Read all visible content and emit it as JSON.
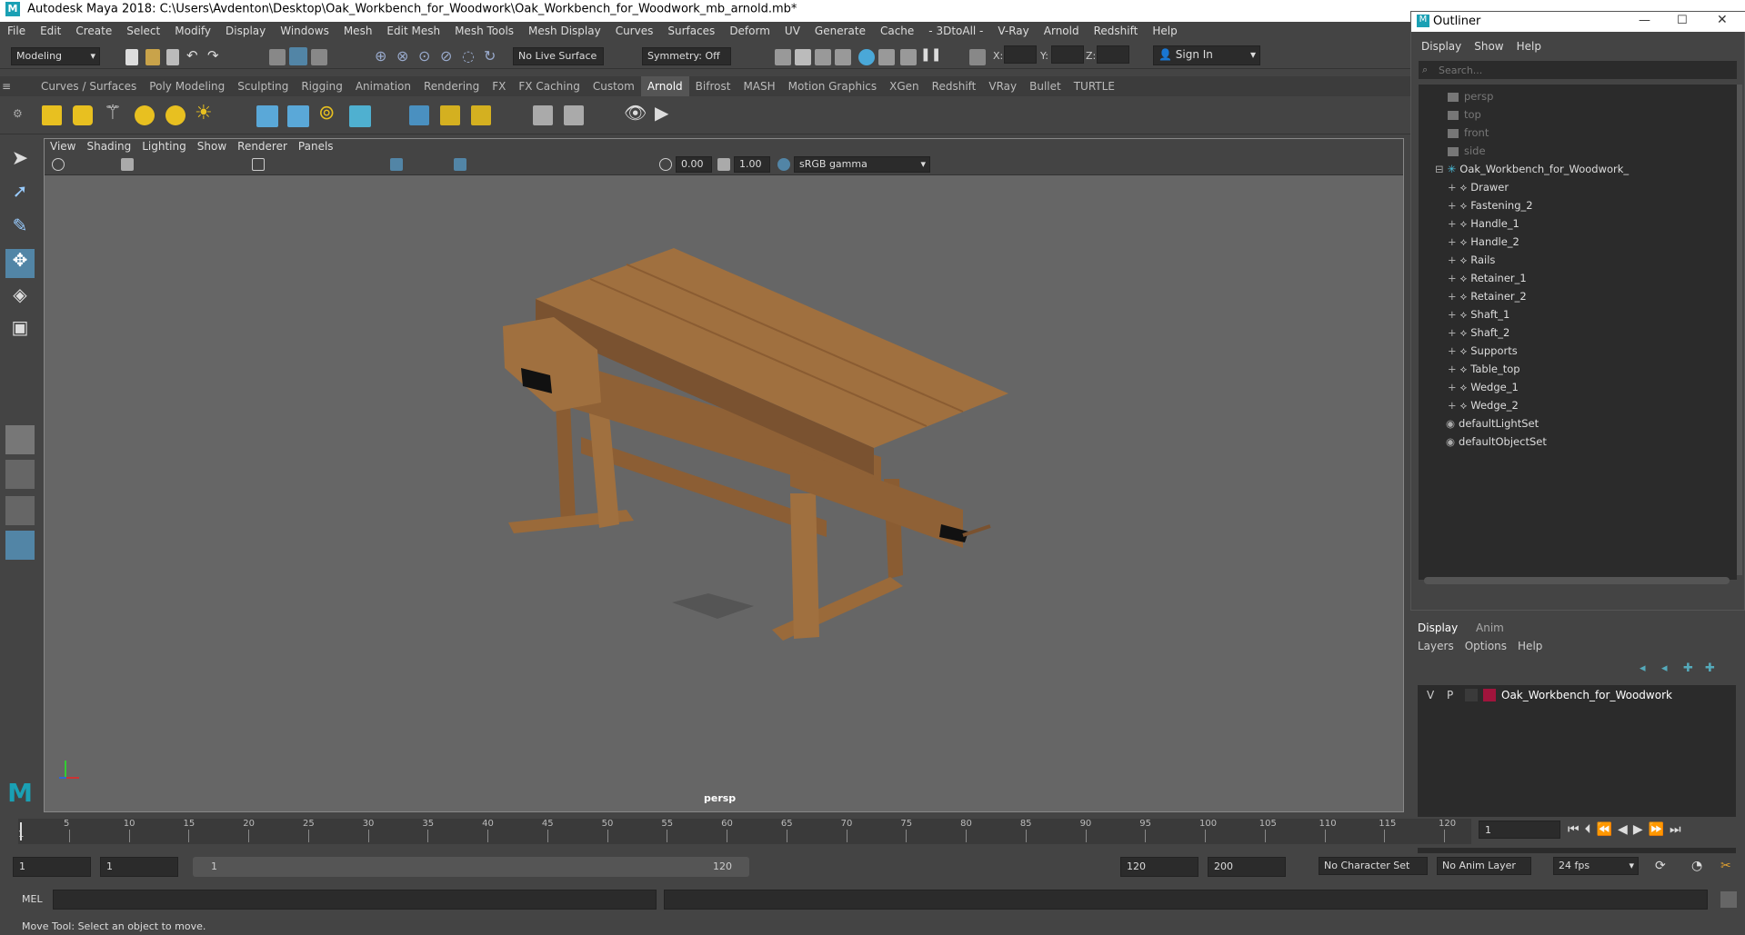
{
  "window": {
    "title": "Autodesk Maya 2018: C:\\Users\\Avdenton\\Desktop\\Oak_Workbench_for_Woodwork\\Oak_Workbench_for_Woodwork_mb_arnold.mb*"
  },
  "menubar": [
    "File",
    "Edit",
    "Create",
    "Select",
    "Modify",
    "Display",
    "Windows",
    "Mesh",
    "Edit Mesh",
    "Mesh Tools",
    "Mesh Display",
    "Curves",
    "Surfaces",
    "Deform",
    "UV",
    "Generate",
    "Cache",
    "- 3DtoAll -",
    "V-Ray",
    "Arnold",
    "Redshift",
    "Help"
  ],
  "statusline": {
    "mode": "Modeling",
    "live_surface": "No Live Surface",
    "symmetry": "Symmetry: Off",
    "x_label": "X:",
    "y_label": "Y:",
    "z_label": "Z:",
    "sign_in": "Sign In"
  },
  "shelf_tabs": [
    "Curves / Surfaces",
    "Poly Modeling",
    "Sculpting",
    "Rigging",
    "Animation",
    "Rendering",
    "FX",
    "FX Caching",
    "Custom",
    "Arnold",
    "Bifrost",
    "MASH",
    "Motion Graphics",
    "XGen",
    "Redshift",
    "VRay",
    "Bullet",
    "TURTLE"
  ],
  "shelf_active": "Arnold",
  "viewport": {
    "menu": [
      "View",
      "Shading",
      "Lighting",
      "Show",
      "Renderer",
      "Panels"
    ],
    "exposure": "0.00",
    "gamma": "1.00",
    "colorspace": "sRGB gamma",
    "camera_label": "persp"
  },
  "outliner": {
    "title": "Outliner",
    "menu": [
      "Display",
      "Show",
      "Help"
    ],
    "search_placeholder": "Search...",
    "cameras": [
      "persp",
      "top",
      "front",
      "side"
    ],
    "root": "Oak_Workbench_for_Woodwork_",
    "children": [
      "Drawer",
      "Fastening_2",
      "Handle_1",
      "Handle_2",
      "Rails",
      "Retainer_1",
      "Retainer_2",
      "Shaft_1",
      "Shaft_2",
      "Supports",
      "Table_top",
      "Wedge_1",
      "Wedge_2"
    ],
    "sets": [
      "defaultLightSet",
      "defaultObjectSet"
    ]
  },
  "layers": {
    "tabs": [
      "Display",
      "Anim"
    ],
    "menu": [
      "Layers",
      "Options",
      "Help"
    ],
    "layer_v": "V",
    "layer_p": "P",
    "layer_name": "Oak_Workbench_for_Woodwork",
    "layer_color": "#a0143c"
  },
  "timeline": {
    "ticks": [
      "5",
      "10",
      "15",
      "20",
      "25",
      "30",
      "35",
      "40",
      "45",
      "50",
      "55",
      "60",
      "65",
      "70",
      "75",
      "80",
      "85",
      "90",
      "95",
      "100",
      "105",
      "110",
      "115",
      "120"
    ],
    "start_marker": "1",
    "current_frame": "1"
  },
  "range": {
    "start": "1",
    "playback_start": "1",
    "slider_start": "1",
    "slider_end": "120",
    "playback_end": "120",
    "end": "200",
    "character_set": "No Character Set",
    "anim_layer": "No Anim Layer",
    "fps": "24 fps"
  },
  "cmdline": {
    "label": "MEL"
  },
  "help_line": "Move Tool: Select an object to move.",
  "colors": {
    "accent": "#5285a6",
    "wood": "#a0703f",
    "wood_dark": "#7a5230"
  }
}
